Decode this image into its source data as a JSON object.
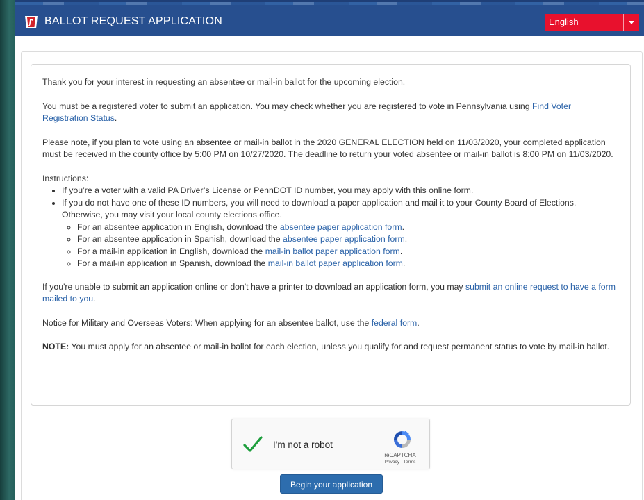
{
  "header": {
    "title": "BALLOT REQUEST APPLICATION",
    "language": "English",
    "colors": {
      "bar": "#274f8f",
      "language_select": "#e8112d"
    }
  },
  "notice": {
    "intro": "Thank you for your interest in requesting an absentee or mail-in ballot for the upcoming election.",
    "registered_text": "You must be a registered voter to submit an application. You may check whether you are registered to vote in Pennsylvania using ",
    "registered_link": "Find Voter Registration Status",
    "registered_end": ".",
    "deadline": "Please note, if you plan to vote using an absentee or mail-in ballot in the 2020 GENERAL ELECTION held on 11/03/2020, your completed application must be received in the county office by 5:00 PM on 10/27/2020. The deadline to return your voted absentee or mail-in ballot is 8:00 PM on 11/03/2020.",
    "instructions_label": "Instructions:",
    "bullet_1": "If you’re a voter with a valid PA Driver’s License or PennDOT ID number, you may apply with this online form.",
    "bullet_2": "If you do not have one of these ID numbers, you will need to download a paper application and mail it to your County Board of Elections. Otherwise, you may visit your local county elections office.",
    "sub_items": [
      {
        "text": "For an absentee application in English, download the ",
        "link": "absentee paper application form",
        "end": "."
      },
      {
        "text": "For an absentee application in Spanish, download the ",
        "link": "absentee paper application form",
        "end": "."
      },
      {
        "text": "For a mail-in application in English, download the ",
        "link": "mail-in ballot paper application form",
        "end": "."
      },
      {
        "text": "For a mail-in application in Spanish, download the ",
        "link": "mail-in ballot paper application form",
        "end": "."
      }
    ],
    "printer_text": "If you're unable to submit an application online or don't have a printer to download an application form, you may ",
    "printer_link": "submit an online request to have a form mailed to you",
    "printer_end": ".",
    "military_text": "Notice for Military and Overseas Voters: When applying for an absentee ballot, use the ",
    "military_link": "federal form",
    "military_end": ".",
    "note_label": "NOTE:",
    "note_text": " You must apply for an absentee or mail-in ballot for each election, unless you qualify for and request permanent status to vote by mail-in ballot."
  },
  "captcha": {
    "label": "I'm not a robot",
    "brand": "reCAPTCHA",
    "links": "Privacy - Terms",
    "checked": true
  },
  "actions": {
    "begin_label": "Begin your application"
  }
}
